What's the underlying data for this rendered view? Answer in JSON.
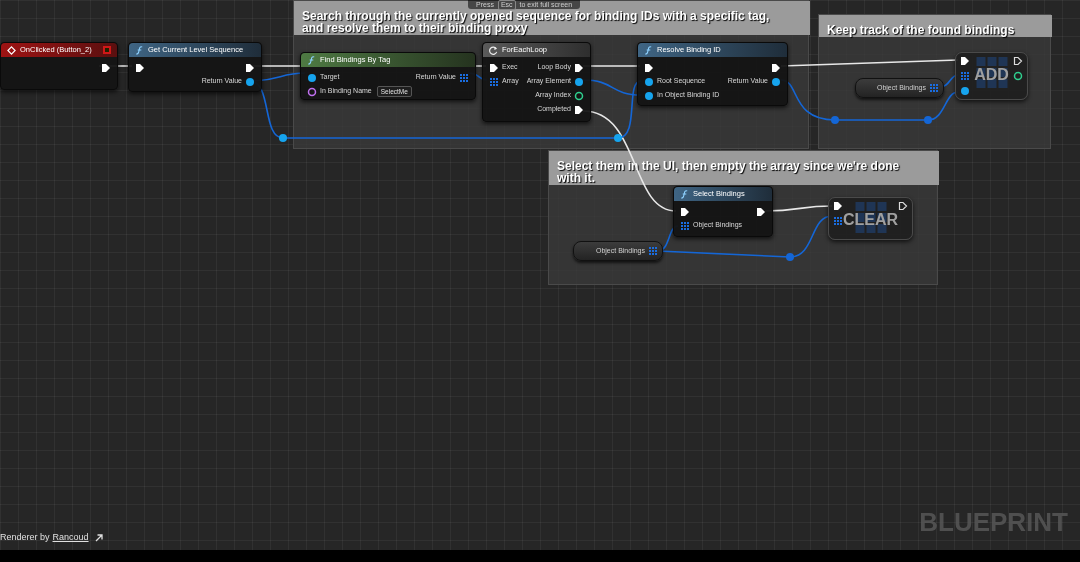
{
  "comments": [
    {
      "text": "Search through the currently opened sequence for binding IDs with a specific tag, and resolve them to their binding proxy"
    },
    {
      "text": "Keep track of the found bindings"
    },
    {
      "text": "Select them in the UI, then empty the array since we're done with it."
    }
  ],
  "nodes": [
    {
      "kind": "event",
      "title": "OnClicked (Button_2)",
      "outputs": [
        {
          "kind": "exec"
        }
      ]
    },
    {
      "kind": "function",
      "title": "Get Current Level Sequence",
      "inputs": [
        {
          "kind": "exec"
        }
      ],
      "outputs": [
        {
          "kind": "exec"
        },
        {
          "kind": "object",
          "label": "Return Value"
        }
      ]
    },
    {
      "kind": "pure_function",
      "title": "Find Bindings By Tag",
      "inputs": [
        {
          "kind": "object",
          "label": "Target"
        },
        {
          "kind": "name",
          "label": "In Binding Name",
          "value": "SelectMe"
        }
      ],
      "outputs": [
        {
          "kind": "array",
          "label": "Return Value"
        }
      ]
    },
    {
      "kind": "macro",
      "title": "ForEachLoop",
      "inputs": [
        {
          "kind": "exec",
          "label": "Exec"
        },
        {
          "kind": "array",
          "label": "Array"
        }
      ],
      "outputs": [
        {
          "kind": "exec",
          "label": "Loop Body"
        },
        {
          "kind": "object",
          "label": "Array Element"
        },
        {
          "kind": "int",
          "label": "Array Index"
        },
        {
          "kind": "exec",
          "label": "Completed"
        }
      ]
    },
    {
      "kind": "function",
      "title": "Resolve Binding ID",
      "inputs": [
        {
          "kind": "exec"
        },
        {
          "kind": "object",
          "label": "Root Sequence"
        },
        {
          "kind": "object",
          "label": "In Object Binding ID"
        }
      ],
      "outputs": [
        {
          "kind": "exec"
        },
        {
          "kind": "object",
          "label": "Return Value"
        }
      ]
    },
    {
      "kind": "compact",
      "title": "ADD",
      "inputs": [
        {
          "kind": "exec"
        },
        {
          "kind": "array"
        },
        {
          "kind": "object"
        }
      ],
      "outputs": [
        {
          "kind": "exec_out"
        },
        {
          "kind": "int"
        }
      ]
    },
    {
      "kind": "variable",
      "title": "Object Bindings",
      "outputs": [
        {
          "kind": "array"
        }
      ]
    },
    {
      "kind": "function",
      "title": "Select Bindings",
      "inputs": [
        {
          "kind": "exec"
        },
        {
          "kind": "array",
          "label": "Object Bindings"
        }
      ],
      "outputs": [
        {
          "kind": "exec"
        }
      ]
    },
    {
      "kind": "compact",
      "title": "CLEAR",
      "inputs": [
        {
          "kind": "exec"
        },
        {
          "kind": "array"
        }
      ],
      "outputs": [
        {
          "kind": "exec_out"
        }
      ]
    },
    {
      "kind": "variable",
      "title": "Object Bindings",
      "outputs": [
        {
          "kind": "array"
        }
      ]
    }
  ],
  "toast": {
    "before": "Press",
    "key": "Esc",
    "after": "to exit full screen"
  },
  "footer": {
    "text": "Renderer by",
    "link": "Rancoud"
  },
  "brand": "BLUEPRINT"
}
